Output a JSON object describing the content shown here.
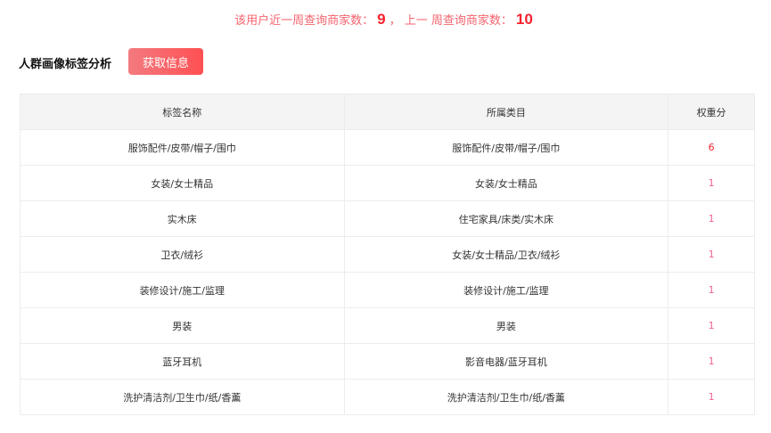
{
  "summary": {
    "prefix": "该用户近一周查询商家数：",
    "current": "9",
    "middle": "，  上一 周查询商家数：",
    "previous": "10"
  },
  "section": {
    "title": "人群画像标签分析",
    "button": "获取信息"
  },
  "table": {
    "headers": [
      "标签名称",
      "所属类目",
      "权重分"
    ],
    "rows": [
      [
        "服饰配件/皮带/帽子/围巾",
        "服饰配件/皮带/帽子/围巾",
        "6"
      ],
      [
        "女装/女士精品",
        "女装/女士精品",
        "1"
      ],
      [
        "实木床",
        "住宅家具/床类/实木床",
        "1"
      ],
      [
        "卫衣/绒衫",
        "女装/女士精品/卫衣/绒衫",
        "1"
      ],
      [
        "装修设计/施工/监理",
        "装修设计/施工/监理",
        "1"
      ],
      [
        "男装",
        "男装",
        "1"
      ],
      [
        "蓝牙耳机",
        "影音电器/蓝牙耳机",
        "1"
      ],
      [
        "洗护清洁剂/卫生巾/纸/香薰",
        "洗护清洁剂/卫生巾/纸/香薰",
        "1"
      ]
    ]
  },
  "colors": {
    "accent": "#f5222d",
    "weight": "#f06292"
  }
}
